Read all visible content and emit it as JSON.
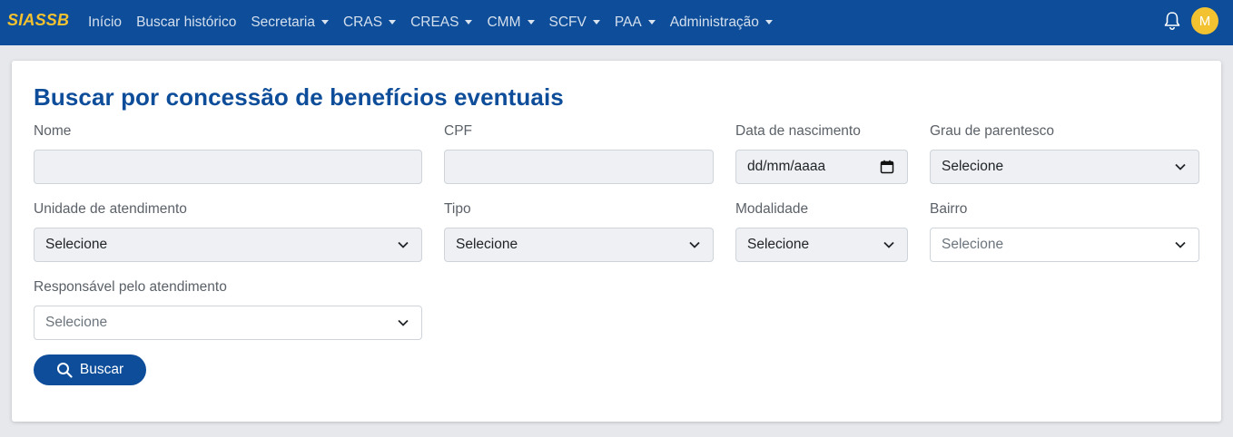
{
  "brand": "SIASSB",
  "nav": [
    {
      "label": "Início",
      "dropdown": false
    },
    {
      "label": "Buscar histórico",
      "dropdown": false
    },
    {
      "label": "Secretaria",
      "dropdown": true
    },
    {
      "label": "CRAS",
      "dropdown": true
    },
    {
      "label": "CREAS",
      "dropdown": true
    },
    {
      "label": "CMM",
      "dropdown": true
    },
    {
      "label": "SCFV",
      "dropdown": true
    },
    {
      "label": "PAA",
      "dropdown": true
    },
    {
      "label": "Administração",
      "dropdown": true
    }
  ],
  "user": {
    "initial": "M"
  },
  "page": {
    "title": "Buscar por concessão de benefícios eventuais"
  },
  "form": {
    "nome": {
      "label": "Nome",
      "value": ""
    },
    "cpf": {
      "label": "CPF",
      "value": ""
    },
    "nascimento": {
      "label": "Data de nascimento",
      "placeholder": "dd/mm/aaaa"
    },
    "parentesco": {
      "label": "Grau de parentesco",
      "value": "Selecione"
    },
    "unidade": {
      "label": "Unidade de atendimento",
      "value": "Selecione"
    },
    "tipo": {
      "label": "Tipo",
      "value": "Selecione"
    },
    "modalidade": {
      "label": "Modalidade",
      "value": "Selecione"
    },
    "bairro": {
      "label": "Bairro",
      "value": "Selecione"
    },
    "responsavel": {
      "label": "Responsável pelo atendimento",
      "value": "Selecione"
    }
  },
  "search_button": "Buscar",
  "colors": {
    "navbar": "#0d4d99",
    "brand": "#f2c230",
    "title": "#0d4d99"
  },
  "icons": {
    "bell": "bell-icon",
    "search": "search-icon",
    "chevron": "chevron-down-icon",
    "calendar": "calendar-icon"
  }
}
